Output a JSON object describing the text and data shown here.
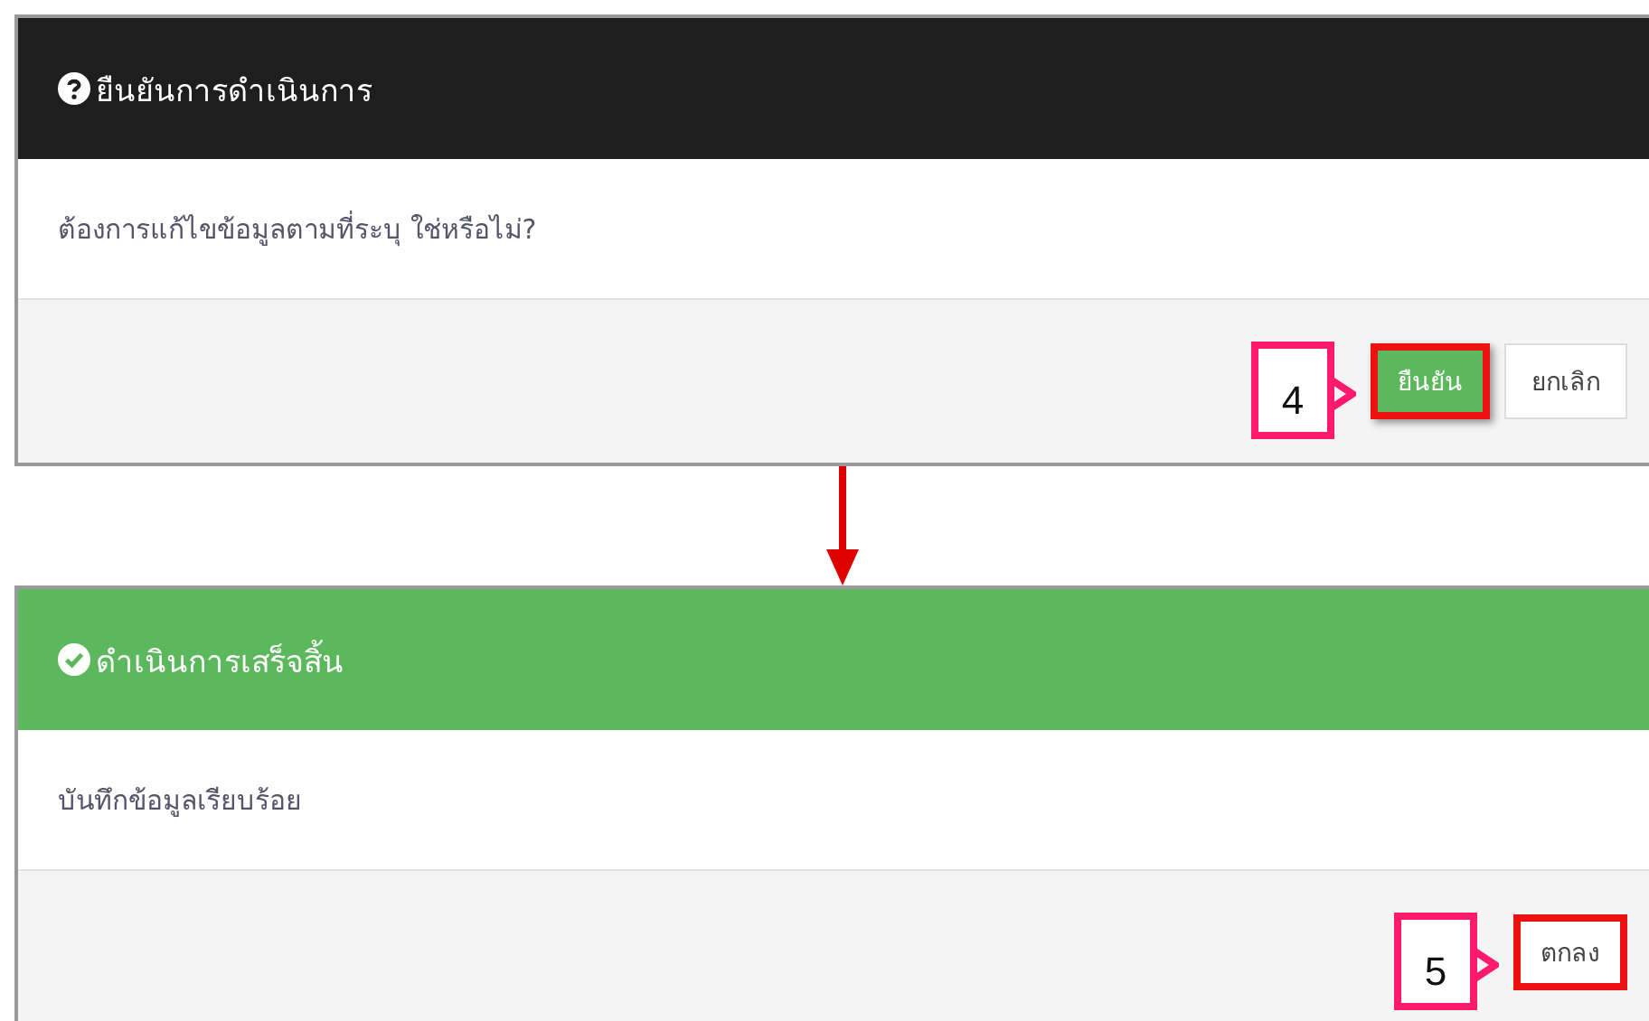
{
  "dialogs": [
    {
      "kind": "question",
      "title": "ยืนยันการดำเนินการ",
      "message": "ต้องการแก้ไขข้อมูลตามที่ระบุ ใช่หรือไม่?",
      "callout": "4",
      "buttons": [
        {
          "label": "ยืนยัน",
          "kind": "primary",
          "highlighted": true
        },
        {
          "label": "ยกเลิก",
          "kind": "default",
          "highlighted": false
        }
      ]
    },
    {
      "kind": "success",
      "title": "ดำเนินการเสร็จสิ้น",
      "message": "บันทึกข้อมูลเรียบร้อย",
      "callout": "5",
      "buttons": [
        {
          "label": "ตกลง",
          "kind": "default",
          "highlighted": true
        }
      ]
    }
  ]
}
